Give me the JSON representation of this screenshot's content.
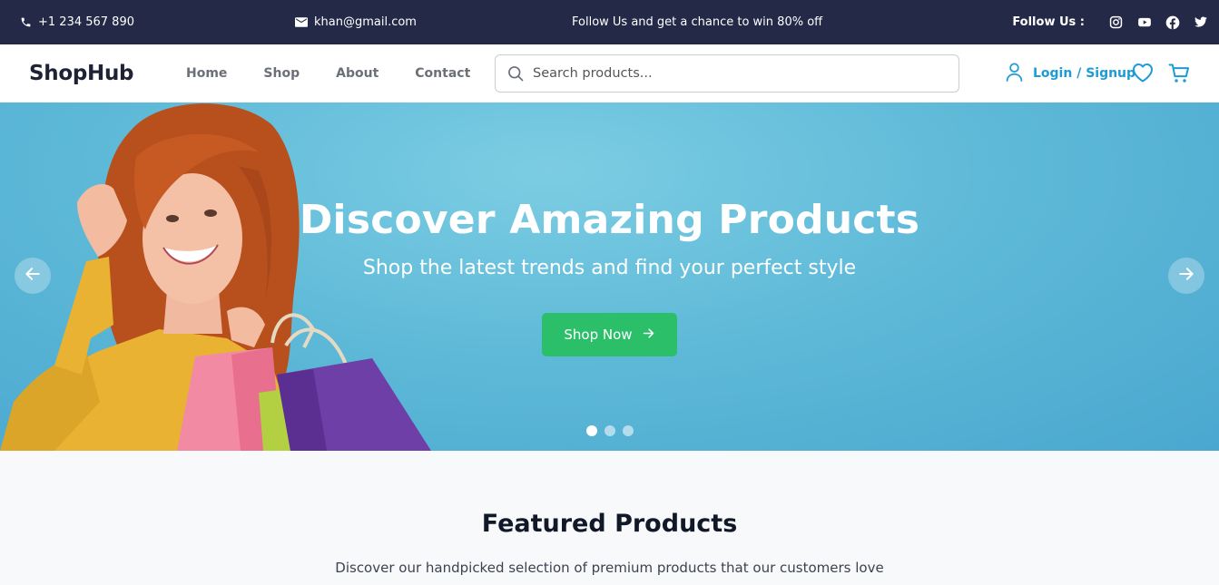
{
  "topbar": {
    "phone": "+1 234 567 890",
    "email": "khan@gmail.com",
    "promo": "Follow Us and get a chance to win 80% off",
    "follow_label": "Follow Us :",
    "social_icons": [
      "instagram-icon",
      "youtube-icon",
      "facebook-icon",
      "twitter-icon"
    ]
  },
  "nav": {
    "logo": "ShopHub",
    "links": [
      "Home",
      "Shop",
      "About",
      "Contact"
    ],
    "search_placeholder": "Search products...",
    "login_label": "Login / Signup"
  },
  "hero": {
    "title": "Discover Amazing Products",
    "subtitle": "Shop the latest trends and find your perfect style",
    "cta_label": "Shop Now",
    "slide_count": 3,
    "active_slide": 1
  },
  "featured": {
    "title": "Featured Products",
    "subtitle": "Discover our handpicked selection of premium products that our customers love"
  },
  "colors": {
    "topbar_bg": "#232946",
    "accent_blue": "#1d9bd6",
    "cta_green": "#2bbf6a",
    "hero_bg": "#5fbad8"
  }
}
